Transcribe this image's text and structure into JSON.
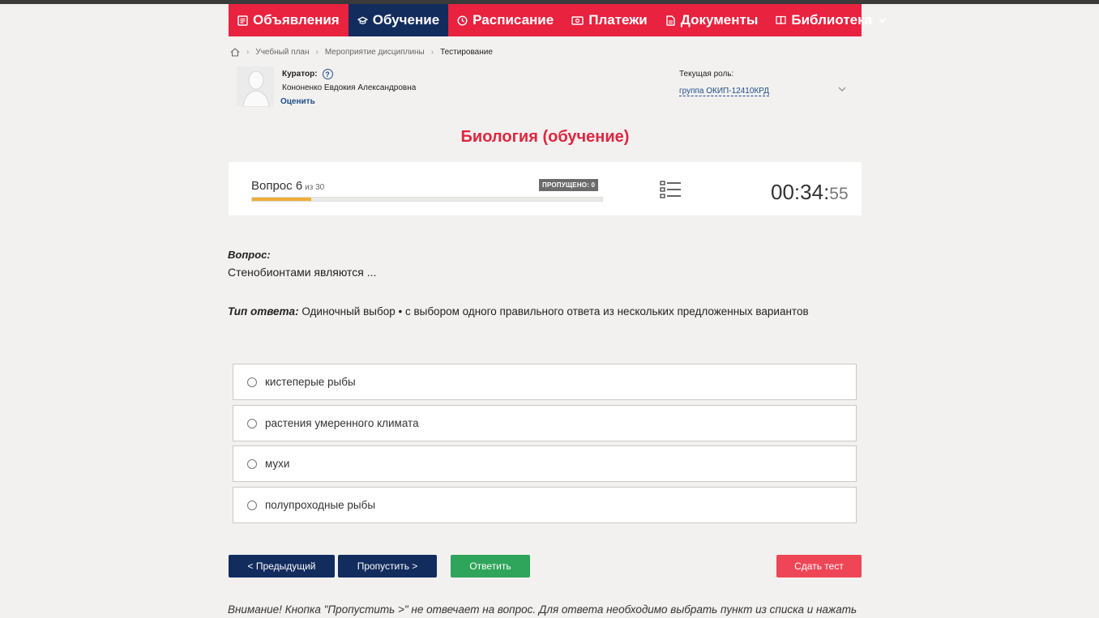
{
  "nav": {
    "items": [
      {
        "label": "Объявления",
        "icon": "news-icon",
        "active": false
      },
      {
        "label": "Обучение",
        "icon": "graduation-cap-icon",
        "active": true
      },
      {
        "label": "Расписание",
        "icon": "clock-icon",
        "active": false
      },
      {
        "label": "Платежи",
        "icon": "money-icon",
        "active": false
      },
      {
        "label": "Документы",
        "icon": "document-icon",
        "active": false
      },
      {
        "label": "Библиотека",
        "icon": "book-icon",
        "active": false
      }
    ]
  },
  "breadcrumb": {
    "items": [
      "Учебный план",
      "Мероприятие дисциплины"
    ],
    "current": "Тестирование"
  },
  "curator": {
    "label": "Куратор:",
    "name": "Кононенко Евдокия Александровна",
    "rate": "Оценить"
  },
  "role": {
    "label": "Текущая роль:",
    "value": "группа ОКИП-12410КРД"
  },
  "title": "Биология (обучение)",
  "progress": {
    "question_label": "Вопрос 6",
    "of_label": "из 30",
    "skipped_label": "ПРОПУЩЕНО: 0",
    "fraction": 0.17
  },
  "timer": {
    "main": "00:34:",
    "seconds": "55"
  },
  "question": {
    "label": "Вопрос:",
    "text": "Стенобионтами являются ...",
    "type_label": "Тип ответа:",
    "type_value": "Одиночный выбор • с выбором одного правильного ответа из нескольких предложенных вариантов"
  },
  "options": [
    "кистеперые рыбы",
    "растения умеренного климата",
    "мухи",
    "полупроходные рыбы"
  ],
  "buttons": {
    "prev": "< Предыдущий",
    "skip": "Пропустить >",
    "answer": "Ответить",
    "finish": "Сдать тест"
  },
  "warning": "Внимание! Кнопка \"Пропустить >\" не отвечает на вопрос. Для ответа необходимо выбрать пункт из списка и нажать",
  "colors": {
    "brand_red": "#e8223f",
    "nav_active": "#132c5e",
    "progress_fill": "#f0ad35",
    "answer_green": "#2ea55a",
    "finish_red": "#ee4656"
  }
}
